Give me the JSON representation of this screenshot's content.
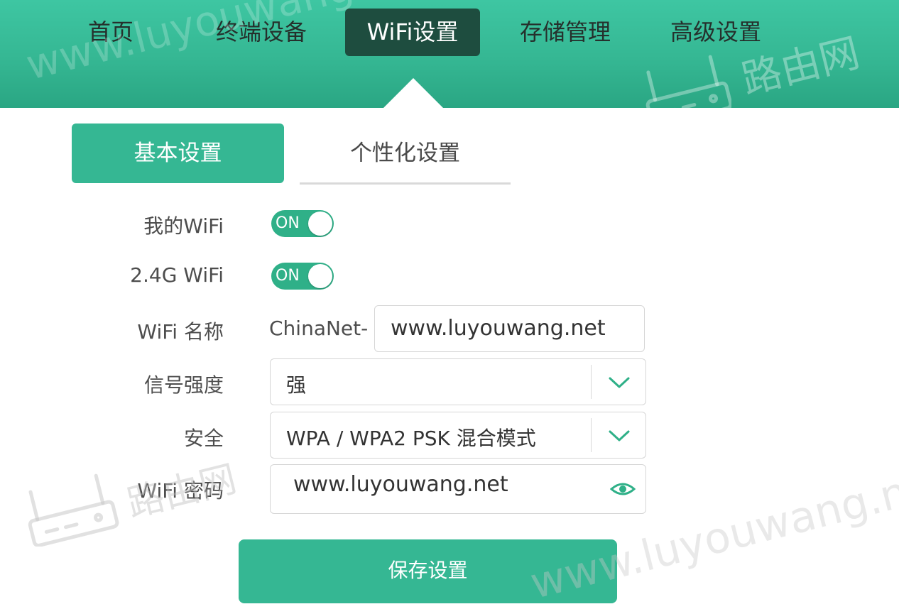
{
  "nav": {
    "items": [
      {
        "label": "首页"
      },
      {
        "label": "终端设备"
      },
      {
        "label": "WiFi设置"
      },
      {
        "label": "存储管理"
      },
      {
        "label": "高级设置"
      }
    ],
    "active": "WiFi设置"
  },
  "subtabs": {
    "basic": "基本设置",
    "personal": "个性化设置"
  },
  "form": {
    "my_wifi": {
      "label": "我的WiFi",
      "state": "ON"
    },
    "wifi_24g": {
      "label": "2.4G WiFi",
      "state": "ON"
    },
    "wifi_name": {
      "label": "WiFi 名称",
      "prefix": "ChinaNet-",
      "value": "www.luyouwang.net"
    },
    "signal": {
      "label": "信号强度",
      "value": "强"
    },
    "security": {
      "label": "安全",
      "value": "WPA / WPA2 PSK 混合模式"
    },
    "password": {
      "label": "WiFi 密码",
      "value": "www.luyouwang.net"
    }
  },
  "save_label": "保存设置",
  "watermark": {
    "url": "www.luyouwang.net",
    "brand": "路由网"
  },
  "colors": {
    "accent": "#35b793",
    "nav_active": "#1e4d3f",
    "toggle_on": "#2fb088"
  }
}
